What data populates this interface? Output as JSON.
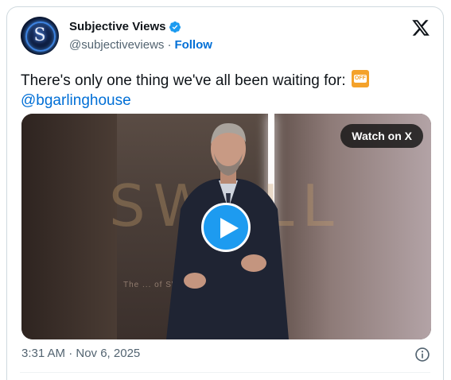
{
  "user": {
    "display_name": "Subjective Views",
    "handle": "@subjectiveviews",
    "separator": "·",
    "follow_label": "Follow",
    "avatar_letter": "S",
    "verified_color": "#1d9bf0"
  },
  "tweet": {
    "text": "There's only one thing we've all been waiting for:",
    "emoji_label": "OFF",
    "mention": "@bgarlinghouse"
  },
  "video": {
    "watch_label": "Watch on X",
    "backdrop_text": "SWELL",
    "backdrop_subline": "The ... of SWELL ... NYC"
  },
  "footer": {
    "timestamp": "3:31 AM · Nov 6, 2025"
  },
  "colors": {
    "accent": "#1d9bf0",
    "link": "#006fd6",
    "muted": "#536471"
  }
}
